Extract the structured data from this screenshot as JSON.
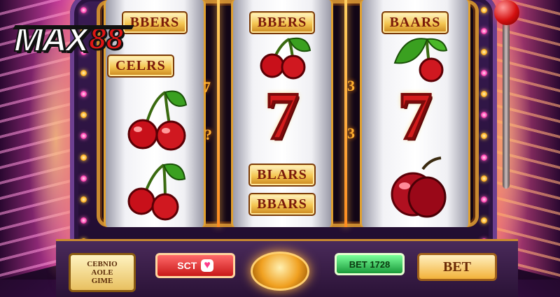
{
  "logo": {
    "brand": "MAX",
    "number": "88"
  },
  "reels": [
    {
      "top_label": "BBERS",
      "mid_label": "CELRS",
      "side_marks": [
        "7",
        "?"
      ]
    },
    {
      "top_label": "BBERS",
      "lower_labels": [
        "BLARS",
        "BBARS"
      ],
      "side_marks": [
        "3",
        "3"
      ]
    },
    {
      "top_label": "BAARS"
    }
  ],
  "reel_symbols": {
    "reel_1": [
      "cherry",
      "cherry",
      "cherry"
    ],
    "reel_2": [
      "cherry",
      "seven",
      "bars"
    ],
    "reel_3": [
      "cherry",
      "seven",
      "plum"
    ]
  },
  "panel": {
    "info_lines": [
      "CEBNIO",
      "AOLE",
      "GIME"
    ],
    "red_button": "SCT",
    "green_button": "BET 1728",
    "bet_button": "BET"
  },
  "colors": {
    "accent_gold": "#f4c550",
    "cherry_red": "#d41c1c",
    "cabinet_purple": "#3b1c55",
    "neon_pink": "#ff40b0"
  }
}
